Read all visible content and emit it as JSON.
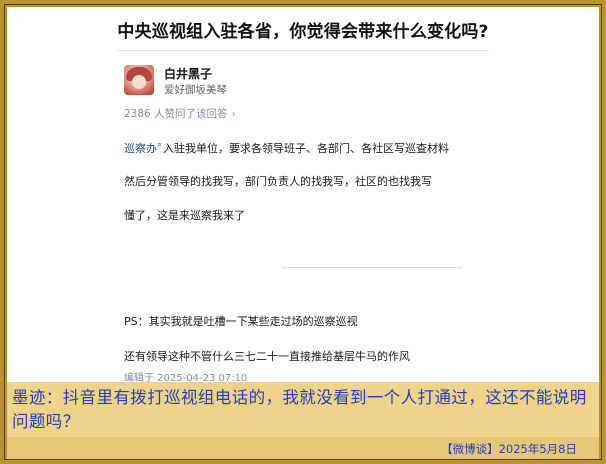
{
  "question": {
    "title": "中央巡视组入驻各省，你觉得会带来什么变化吗?"
  },
  "author": {
    "name": "白井黑子",
    "bio": "爱好御坂美琴"
  },
  "answer": {
    "upvotes_text": "2386 人赞同了该回答",
    "link_word": "巡察办",
    "p1_rest": "入驻我单位，要求各领导班子、各部门、各社区写巡查材料",
    "p2": "然后分管领导的找我写，部门负责人的找我写，社区的也找我写",
    "p3": "懂了，这是来巡察我来了",
    "p4": "PS：其实我就是吐槽一下某些走过场的巡察巡视",
    "p5": "还有领导这种不管什么三七二十一直接推给基层牛马的作风",
    "edit_time": "编辑于 2025-04-23 07:10"
  },
  "comment": {
    "text": "墨迹：抖音里有拨打巡视组电话的，我就没看到一个人打通过，这还不能说明问题吗？"
  },
  "signature": {
    "text": "【微博谈】2025年5月8日"
  },
  "colors": {
    "frame": "#b8932f",
    "comment_bg": "#efd38a",
    "comment_text": "#1f3fbf",
    "link": "#175199"
  }
}
